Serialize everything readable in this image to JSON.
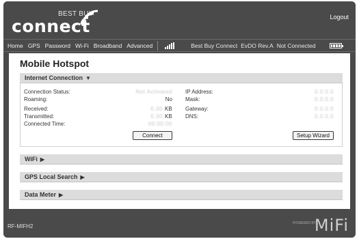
{
  "header": {
    "logo_top": "BEST BUY",
    "logo_main": "connect",
    "logout_label": "Logout"
  },
  "nav": {
    "items": [
      "Home",
      "GPS",
      "Password",
      "Wi-Fi",
      "Broadband",
      "Advanced"
    ],
    "status": {
      "network": "Best Buy Connect",
      "technology": "EvDO Rev.A",
      "connection": "Not Connected"
    }
  },
  "page": {
    "title": "Mobile Hotspot"
  },
  "internet_connection": {
    "header": "Internet Connection",
    "labels": {
      "connection_status": "Connection Status:",
      "roaming": "Roaming:",
      "received": "Received:",
      "transmitted": "Transmitted:",
      "connected_time": "Connected Time:",
      "ip_address": "IP Address:",
      "mask": "Mask:",
      "gateway": "Gateway:",
      "dns": "DNS:"
    },
    "values": {
      "connection_status": "Not Activated",
      "roaming": "No",
      "received": "0.00",
      "received_unit": "KB",
      "transmitted": "0.00",
      "transmitted_unit": "KB",
      "connected_time": "00:00:00",
      "ip_address": "0.0.0.0",
      "mask": "0.0.0.0",
      "gateway": "0.0.0.0",
      "dns": "0.0.0.0"
    },
    "connect_button": "Connect",
    "setup_wizard_button": "Setup Wizard"
  },
  "sections": {
    "wifi": "WiFi",
    "gps_local_search": "GPS Local Search",
    "data_meter": "Data Meter"
  },
  "footer": {
    "model": "RF-MIFH2",
    "powered_by": "POWERED BY",
    "brand": "MiFi"
  }
}
